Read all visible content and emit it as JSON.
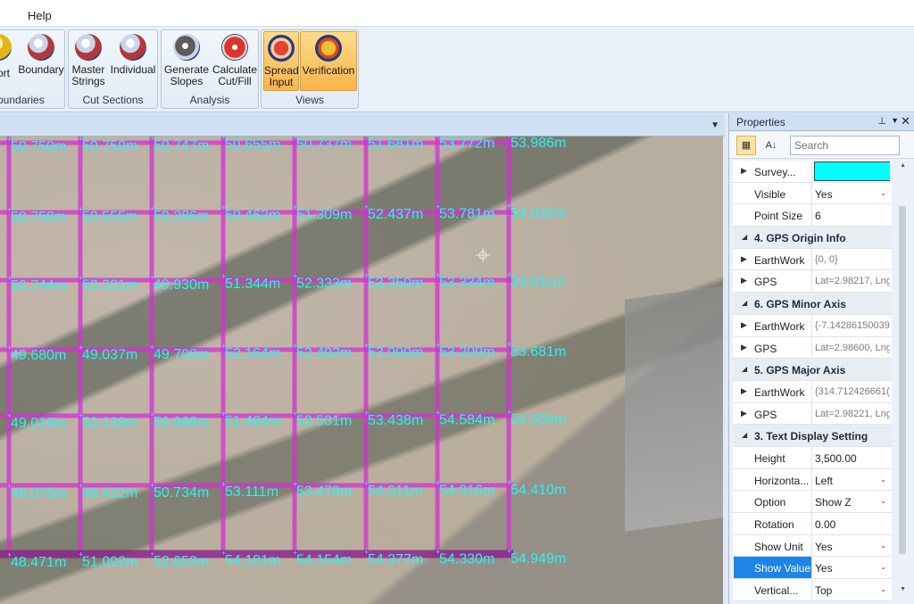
{
  "menu": {
    "items": [
      {
        "label": "Help"
      }
    ]
  },
  "ribbon": {
    "groups": [
      {
        "title": "oundaries",
        "buttons": [
          {
            "label": "ort",
            "icon": "import-icon"
          },
          {
            "label": "Boundary",
            "icon": "boundary-icon"
          }
        ]
      },
      {
        "title": "Cut Sections",
        "buttons": [
          {
            "label": "Master Strings",
            "icon": "master-strings-icon"
          },
          {
            "label": "Individual",
            "icon": "individual-icon"
          }
        ]
      },
      {
        "title": "Analysis",
        "buttons": [
          {
            "label": "Generate Slopes",
            "icon": "generate-slopes-icon"
          },
          {
            "label": "Calculate Cut/Fill",
            "icon": "calculate-cut-fill-icon"
          }
        ]
      },
      {
        "title": "Views",
        "buttons": [
          {
            "label": "Spread Input",
            "icon": "spread-input-icon"
          },
          {
            "label": "Verification",
            "icon": "verification-icon"
          }
        ]
      }
    ]
  },
  "map": {
    "label_color": "#29f3f7",
    "grid_color": "#d62fd2",
    "rows": [
      [
        "50.750m",
        "50.750m",
        "50.747m",
        "50.655m",
        "50.737m",
        "51.681m",
        "53.772m",
        "53.986m"
      ],
      [
        "50.750m",
        "50.555m",
        "50.286m",
        "50.462m",
        "51.309m",
        "52.437m",
        "53.781m",
        "54.032m"
      ],
      [
        "50.744m",
        "50.321m",
        "49.930m",
        "51.344m",
        "52.333m",
        "53.350m",
        "53.334m",
        "54.011m"
      ],
      [
        "49.680m",
        "49.037m",
        "49.708m",
        "52.164m",
        "52.492m",
        "53.090m",
        "53.209m",
        "53.681m"
      ],
      [
        "49.016m",
        "50.130m",
        "50.968m",
        "51.484m",
        "52.531m",
        "53.438m",
        "54.584m",
        "54.559m"
      ],
      [
        "49.075m",
        "49.422m",
        "50.734m",
        "53.111m",
        "53.478m",
        "54.011m",
        "54.916m",
        "54.410m"
      ],
      [
        "48.471m",
        "51.092m",
        "52.653m",
        "54.181m",
        "54.154m",
        "54.377m",
        "54.330m",
        "54.949m"
      ]
    ]
  },
  "properties": {
    "title": "Properties",
    "search_placeholder": "Search",
    "rows": [
      {
        "type": "prop",
        "name": "Survey...",
        "expandable": true,
        "swatch": "#00ffff"
      },
      {
        "type": "prop",
        "name": "Visible",
        "value": "Yes",
        "dropdown": true
      },
      {
        "type": "prop",
        "name": "Point Size",
        "value": "6"
      },
      {
        "type": "category",
        "name": "4. GPS Origin Info"
      },
      {
        "type": "prop",
        "name": "EarthWork",
        "expandable": true,
        "value": "{0, 0}",
        "muted": true
      },
      {
        "type": "prop",
        "name": "GPS",
        "expandable": true,
        "value": "Lat=2.98217, Lng",
        "muted": true
      },
      {
        "type": "category",
        "name": "6. GPS Minor Axis"
      },
      {
        "type": "prop",
        "name": "EarthWork",
        "expandable": true,
        "value": "{-7.14286150039",
        "muted": true
      },
      {
        "type": "prop",
        "name": "GPS",
        "expandable": true,
        "value": "Lat=2.98600, Lng",
        "muted": true
      },
      {
        "type": "category",
        "name": "5. GPS Major Axis"
      },
      {
        "type": "prop",
        "name": "EarthWork",
        "expandable": true,
        "value": "{314.712426661(",
        "muted": true
      },
      {
        "type": "prop",
        "name": "GPS",
        "expandable": true,
        "value": "Lat=2.98221, Lng",
        "muted": true
      },
      {
        "type": "category",
        "name": "3. Text Display Setting"
      },
      {
        "type": "prop",
        "name": "Height",
        "value": "3,500.00"
      },
      {
        "type": "prop",
        "name": "Horizonta...",
        "value": "Left",
        "dropdown": true
      },
      {
        "type": "prop",
        "name": "Option",
        "value": "Show Z",
        "dropdown": true
      },
      {
        "type": "prop",
        "name": "Rotation",
        "value": "0.00"
      },
      {
        "type": "prop",
        "name": "Show Unit",
        "value": "Yes",
        "dropdown": true
      },
      {
        "type": "prop",
        "name": "Show Value",
        "value": "Yes",
        "dropdown": true,
        "selected": true
      },
      {
        "type": "prop",
        "name": "Vertical...",
        "value": "Top",
        "dropdown": true
      }
    ]
  }
}
